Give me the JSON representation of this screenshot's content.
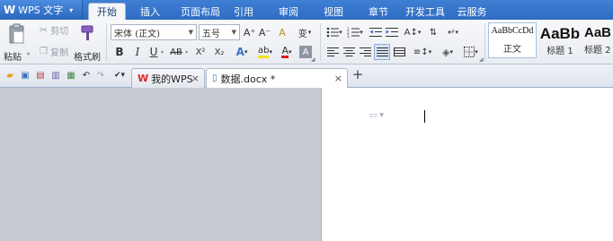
{
  "app": {
    "logo": "W",
    "name": "WPS 文字",
    "menu_arrow": "▾"
  },
  "menu_tabs": [
    "开始",
    "插入",
    "页面布局",
    "引用",
    "审阅",
    "视图",
    "章节",
    "开发工具",
    "云服务"
  ],
  "clipboard": {
    "paste": "粘贴",
    "cut": "剪切",
    "copy": "复制",
    "format_painter": "格式刷"
  },
  "font": {
    "family": "宋体 (正文)",
    "size": "五号",
    "grow": "A⁺",
    "shrink": "A⁻",
    "bold": "B",
    "italic": "I",
    "underline": "U",
    "strike": "AB",
    "superscript": "X²",
    "subscript": "X₂",
    "text_effect": "A",
    "highlight": "ab",
    "font_color": "A",
    "char_shade": "A",
    "phonetic": "变",
    "clear": "A"
  },
  "styles": [
    {
      "sample": "AaBbCcDd",
      "name": "正文"
    },
    {
      "sample": "AaBb",
      "name": "标题 1"
    },
    {
      "sample": "AaB",
      "name": "标题 2"
    }
  ],
  "colors": {
    "title_blue": "#2f6cc2",
    "highlight_yellow": "#f5e21b",
    "font_red": "#e21b1b",
    "wps_red": "#d9282f"
  },
  "doc_tabs": [
    {
      "label": "我的WPS"
    },
    {
      "label": "数据.docx *"
    }
  ],
  "new_tab": "+",
  "close": "×"
}
